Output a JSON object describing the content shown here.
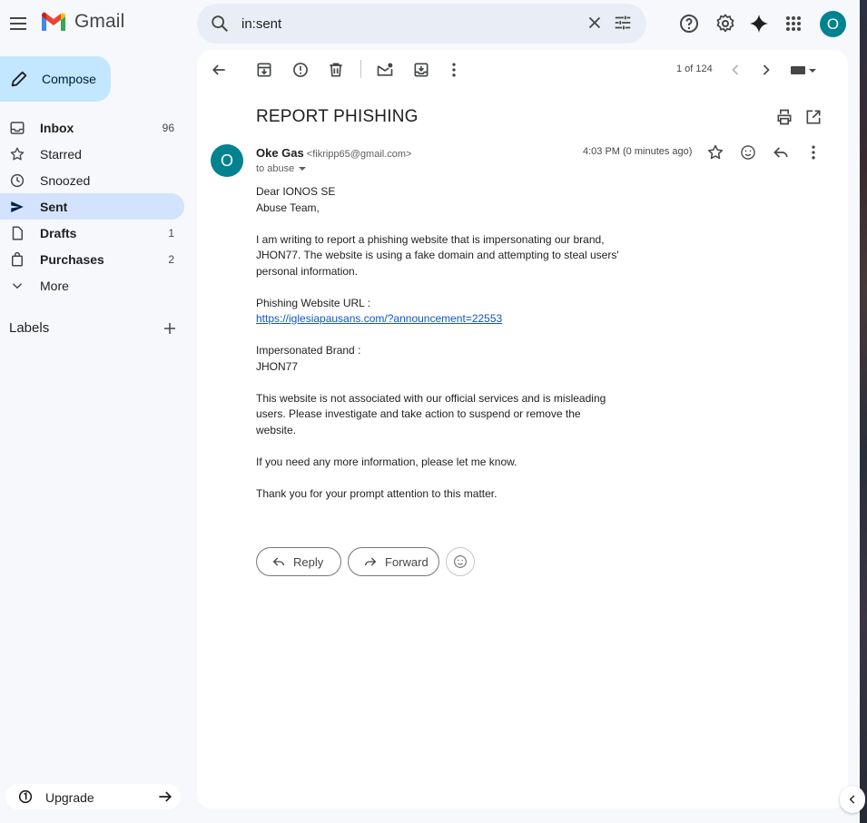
{
  "app": {
    "logo_text": "Gmail"
  },
  "search": {
    "value": "in:sent"
  },
  "sidebar": {
    "compose_label": "Compose",
    "items": [
      {
        "label": "Inbox",
        "count": "96"
      },
      {
        "label": "Starred",
        "count": ""
      },
      {
        "label": "Snoozed",
        "count": ""
      },
      {
        "label": "Sent",
        "count": ""
      },
      {
        "label": "Drafts",
        "count": "1"
      },
      {
        "label": "Purchases",
        "count": "2"
      },
      {
        "label": "More",
        "count": ""
      }
    ],
    "labels_heading": "Labels",
    "upgrade_label": "Upgrade"
  },
  "user": {
    "avatar_letter": "O"
  },
  "toolbar": {
    "page_count": "1 of 124"
  },
  "email": {
    "subject": "REPORT PHISHING",
    "sender_initial": "O",
    "sender_name": "Oke Gas",
    "sender_email": "<fikripp65@gmail.com>",
    "to_line": "to abuse",
    "time": "4:03 PM (0 minutes ago)",
    "body": {
      "line1": "Dear IONOS SE",
      "line2": "Abuse Team,",
      "para1": "I am writing to report a phishing website that is impersonating our brand, JHON77. The website is using a fake domain and attempting to steal users' personal information.",
      "url_label": "Phishing Website URL :",
      "url": "https://iglesiapausans.com/?announcement=22553",
      "brand_label": "Impersonated Brand :",
      "brand": "JHON77",
      "para2": "This website is not associated with our official services and is misleading users. Please investigate and take action to suspend or remove the website.",
      "para3": "If you need any more information, please let me know.",
      "para4": "Thank you for your prompt attention to this matter."
    },
    "reply_label": "Reply",
    "forward_label": "Forward"
  },
  "colors": {
    "accent": "#c2e7ff",
    "active_nav": "#d3e3fd",
    "avatar": "#00838f",
    "link": "#1155cc",
    "background": "#f6f8fc"
  },
  "icons": {
    "topbar": [
      "menu-icon",
      "gmail-logo",
      "search-icon",
      "close-icon",
      "tune-icon",
      "help-icon",
      "settings-icon",
      "gemini-icon",
      "apps-icon"
    ],
    "toolbar": [
      "back-arrow-icon",
      "archive-icon",
      "report-spam-icon",
      "delete-icon",
      "mark-unread-icon",
      "move-to-icon",
      "more-vert-icon",
      "chevron-left-icon",
      "chevron-right-icon",
      "keyboard-icon"
    ]
  }
}
